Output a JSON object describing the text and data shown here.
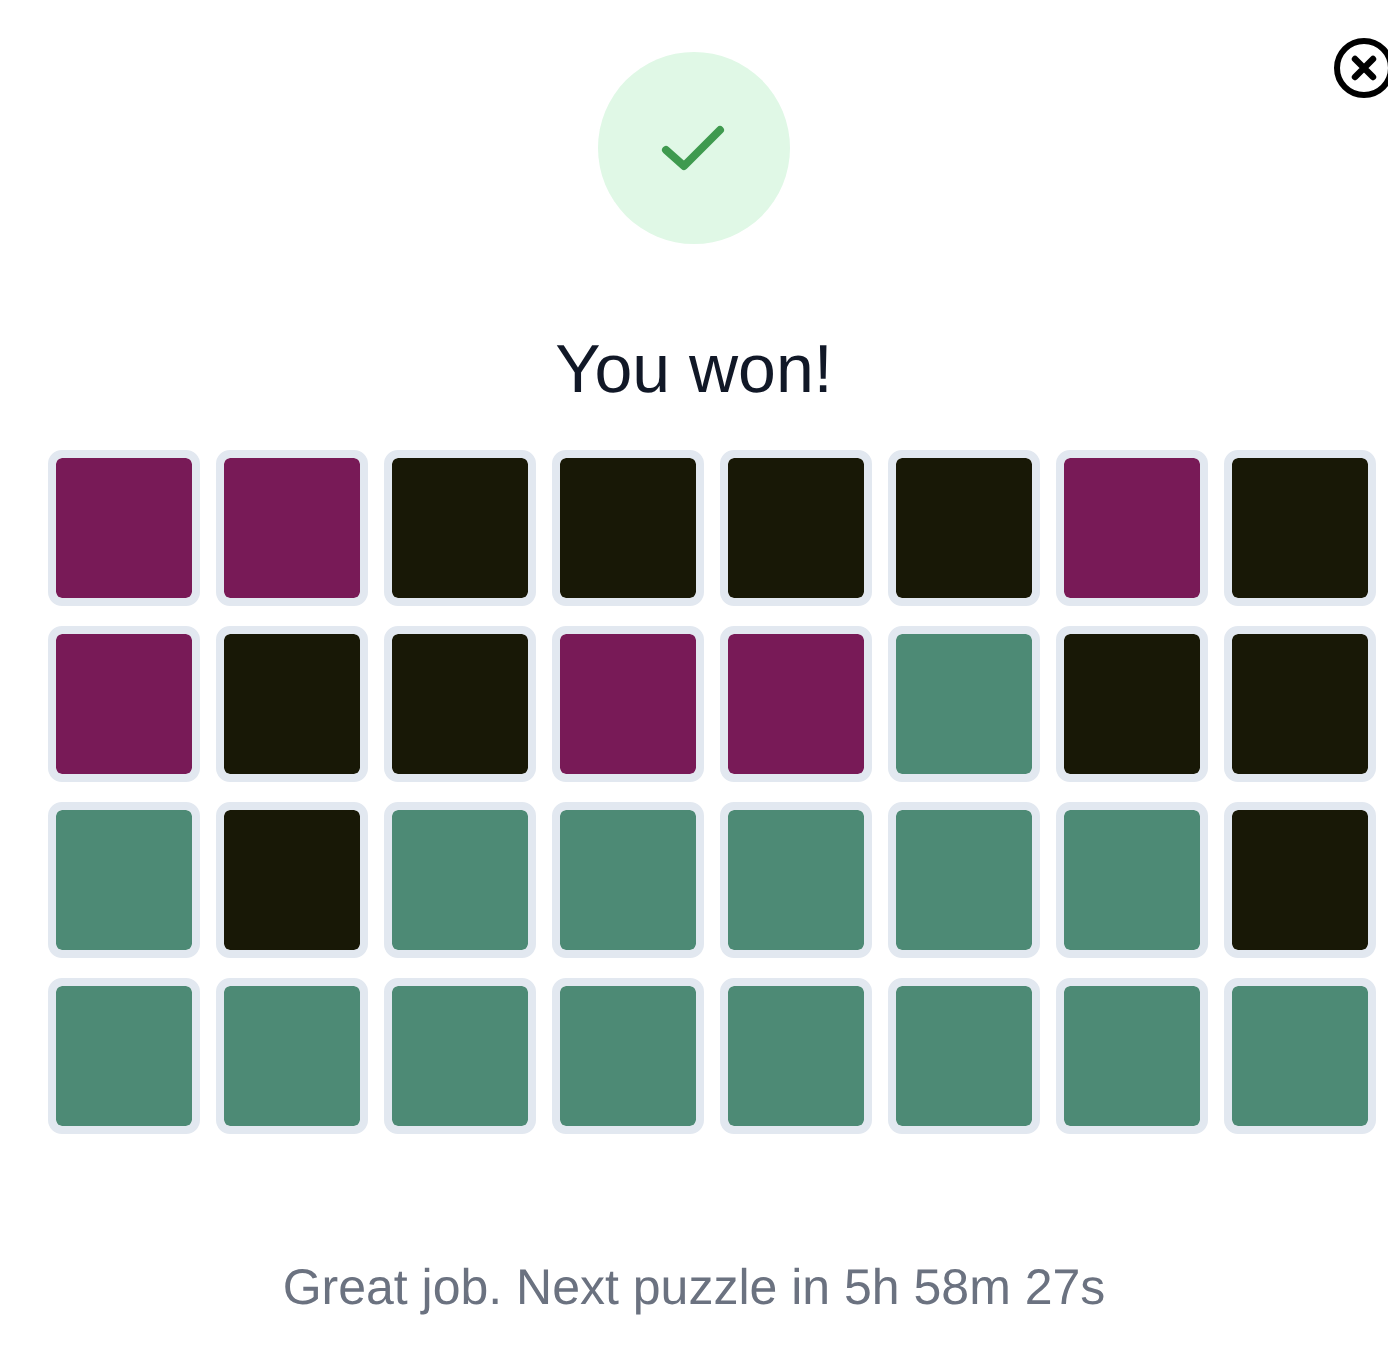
{
  "dialog": {
    "title": "You won!",
    "message": "Great job. Next puzzle in 5h 58m 27s"
  },
  "grid": [
    [
      {
        "color": "#781a57"
      },
      {
        "color": "#781a57"
      },
      {
        "color": "#181806"
      },
      {
        "color": "#181806"
      },
      {
        "color": "#181806"
      },
      {
        "color": "#181806"
      },
      {
        "color": "#781a57"
      },
      {
        "color": "#181806"
      }
    ],
    [
      {
        "color": "#781a57"
      },
      {
        "color": "#181806"
      },
      {
        "color": "#181806"
      },
      {
        "color": "#781a57"
      },
      {
        "color": "#781a57"
      },
      {
        "color": "#4d8a75"
      },
      {
        "color": "#181806"
      },
      {
        "color": "#181806"
      }
    ],
    [
      {
        "color": "#4d8a75"
      },
      {
        "color": "#181806"
      },
      {
        "color": "#4d8a75"
      },
      {
        "color": "#4d8a75"
      },
      {
        "color": "#4d8a75"
      },
      {
        "color": "#4d8a75"
      },
      {
        "color": "#4d8a75"
      },
      {
        "color": "#181806"
      }
    ],
    [
      {
        "color": "#4d8a75"
      },
      {
        "color": "#4d8a75"
      },
      {
        "color": "#4d8a75"
      },
      {
        "color": "#4d8a75"
      },
      {
        "color": "#4d8a75"
      },
      {
        "color": "#4d8a75"
      },
      {
        "color": "#4d8a75"
      },
      {
        "color": "#4d8a75"
      }
    ]
  ]
}
